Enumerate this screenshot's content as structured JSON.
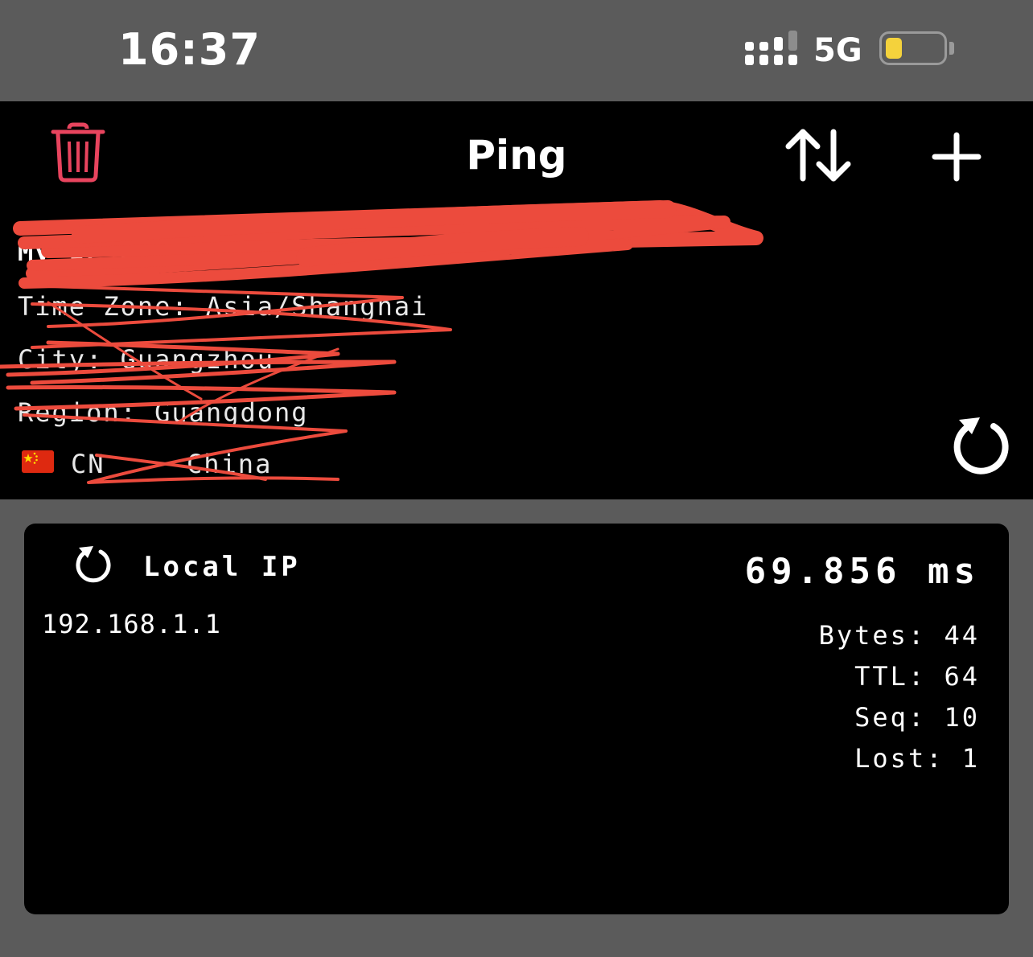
{
  "status_bar": {
    "time": "16:37",
    "network": "5G",
    "battery_level": 0.15,
    "battery_color": "#f4d23c"
  },
  "nav": {
    "title": "Ping",
    "left_icon": "trash-icon",
    "right_icons": [
      "sort-arrows-icon",
      "plus-icon"
    ],
    "accent_color": "#e8445e"
  },
  "ip_info": {
    "my_ip_label": "My IP Address:",
    "timezone": "Time Zone: Asia/Shanghai",
    "city": "City: Guangzhou",
    "region": "Region: Guangdong",
    "country_code": "CN",
    "country_name": "China",
    "flag_icon": "china-flag-icon",
    "refresh_icon": "refresh-icon"
  },
  "ping_card": {
    "title": "Local IP",
    "ip": "192.168.1.1",
    "latency": "69.856 ms",
    "bytes": "Bytes: 44",
    "ttl": "TTL: 64",
    "seq": "Seq: 10",
    "lost": "Lost: 1"
  }
}
